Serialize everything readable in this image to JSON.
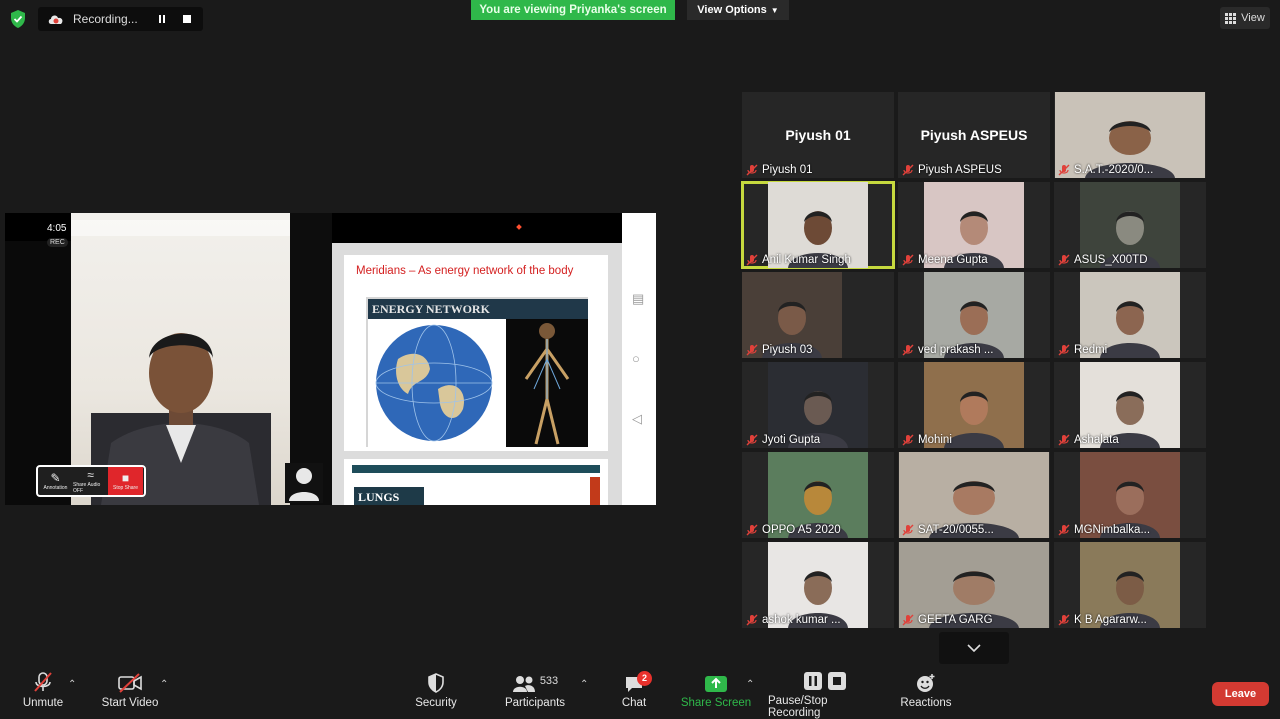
{
  "recording": {
    "label": "Recording..."
  },
  "banner": {
    "viewing": "You are viewing Priyanka's screen",
    "view_options": "View Options"
  },
  "view_button": {
    "label": "View"
  },
  "shared_screen": {
    "status_time": "4:05",
    "rec_tag": "REC",
    "slide_title": "Meridians – As energy network of the body",
    "energy_network_title": "ENERGY NETWORK",
    "lungs_title": "LUNGS",
    "phone_toolbar": [
      {
        "label": "Annotation"
      },
      {
        "label": "Share Audio OFF"
      },
      {
        "label": "Stop Share"
      }
    ]
  },
  "participants": [
    {
      "name": "Piyush 01",
      "video": false
    },
    {
      "name": "Piyush ASPEUS",
      "video": false
    },
    {
      "name": "S.A.T.-2020/0...",
      "video": true,
      "bg": "#c9c2b8",
      "skin": "#8a6248"
    },
    {
      "name": "Anil Kumar Singh",
      "video": true,
      "bg": "#dedbd6",
      "skin": "#6d4a36",
      "active": true
    },
    {
      "name": "Meena Gupta",
      "video": true,
      "bg": "#d8c6c4",
      "skin": "#b48a78"
    },
    {
      "name": "ASUS_X00TD",
      "video": true,
      "bg": "#3e443c",
      "skin": "#8a8a80"
    },
    {
      "name": "Piyush 03",
      "video": true,
      "bg": "#4a3f38",
      "skin": "#7a5a48"
    },
    {
      "name": "ved prakash ...",
      "video": true,
      "bg": "#a7a9a3",
      "skin": "#9b6e56"
    },
    {
      "name": "Redmi",
      "video": true,
      "bg": "#cbc6bd",
      "skin": "#8c6550"
    },
    {
      "name": "Jyoti Gupta",
      "video": true,
      "bg": "#2b2d33",
      "skin": "#6a5a52"
    },
    {
      "name": "Mohini",
      "video": true,
      "bg": "#8f6f4c",
      "skin": "#b07a5c"
    },
    {
      "name": "Ashalata",
      "video": true,
      "bg": "#e4e0da",
      "skin": "#8a6d5a"
    },
    {
      "name": "OPPO A5 2020",
      "video": true,
      "bg": "#5b7d5d",
      "skin": "#b8883a"
    },
    {
      "name": "SAT-20/0055...",
      "video": true,
      "bg": "#b8afa3",
      "skin": "#a87a62"
    },
    {
      "name": "MGNimbalka...",
      "video": true,
      "bg": "#7a4e40",
      "skin": "#9b6e5c"
    },
    {
      "name": "ashok kumar ...",
      "video": true,
      "bg": "#e8e6e4",
      "skin": "#8a6c58"
    },
    {
      "name": "GEETA GARG",
      "video": true,
      "bg": "#a39e94",
      "skin": "#a07c66"
    },
    {
      "name": "K B Agararw...",
      "video": true,
      "bg": "#8a7a5a",
      "skin": "#7c5c46"
    }
  ],
  "toolbar": {
    "unmute": "Unmute",
    "start_video": "Start Video",
    "security": "Security",
    "participants": "Participants",
    "participant_count": "533",
    "chat": "Chat",
    "chat_badge": "2",
    "share_screen": "Share Screen",
    "pause_stop_recording": "Pause/Stop Recording",
    "reactions": "Reactions",
    "leave": "Leave"
  },
  "colors": {
    "accent_green": "#2fb84a",
    "leave_red": "#d33a32",
    "active_speaker": "#c6d93e",
    "muted_red": "#e0413a"
  }
}
